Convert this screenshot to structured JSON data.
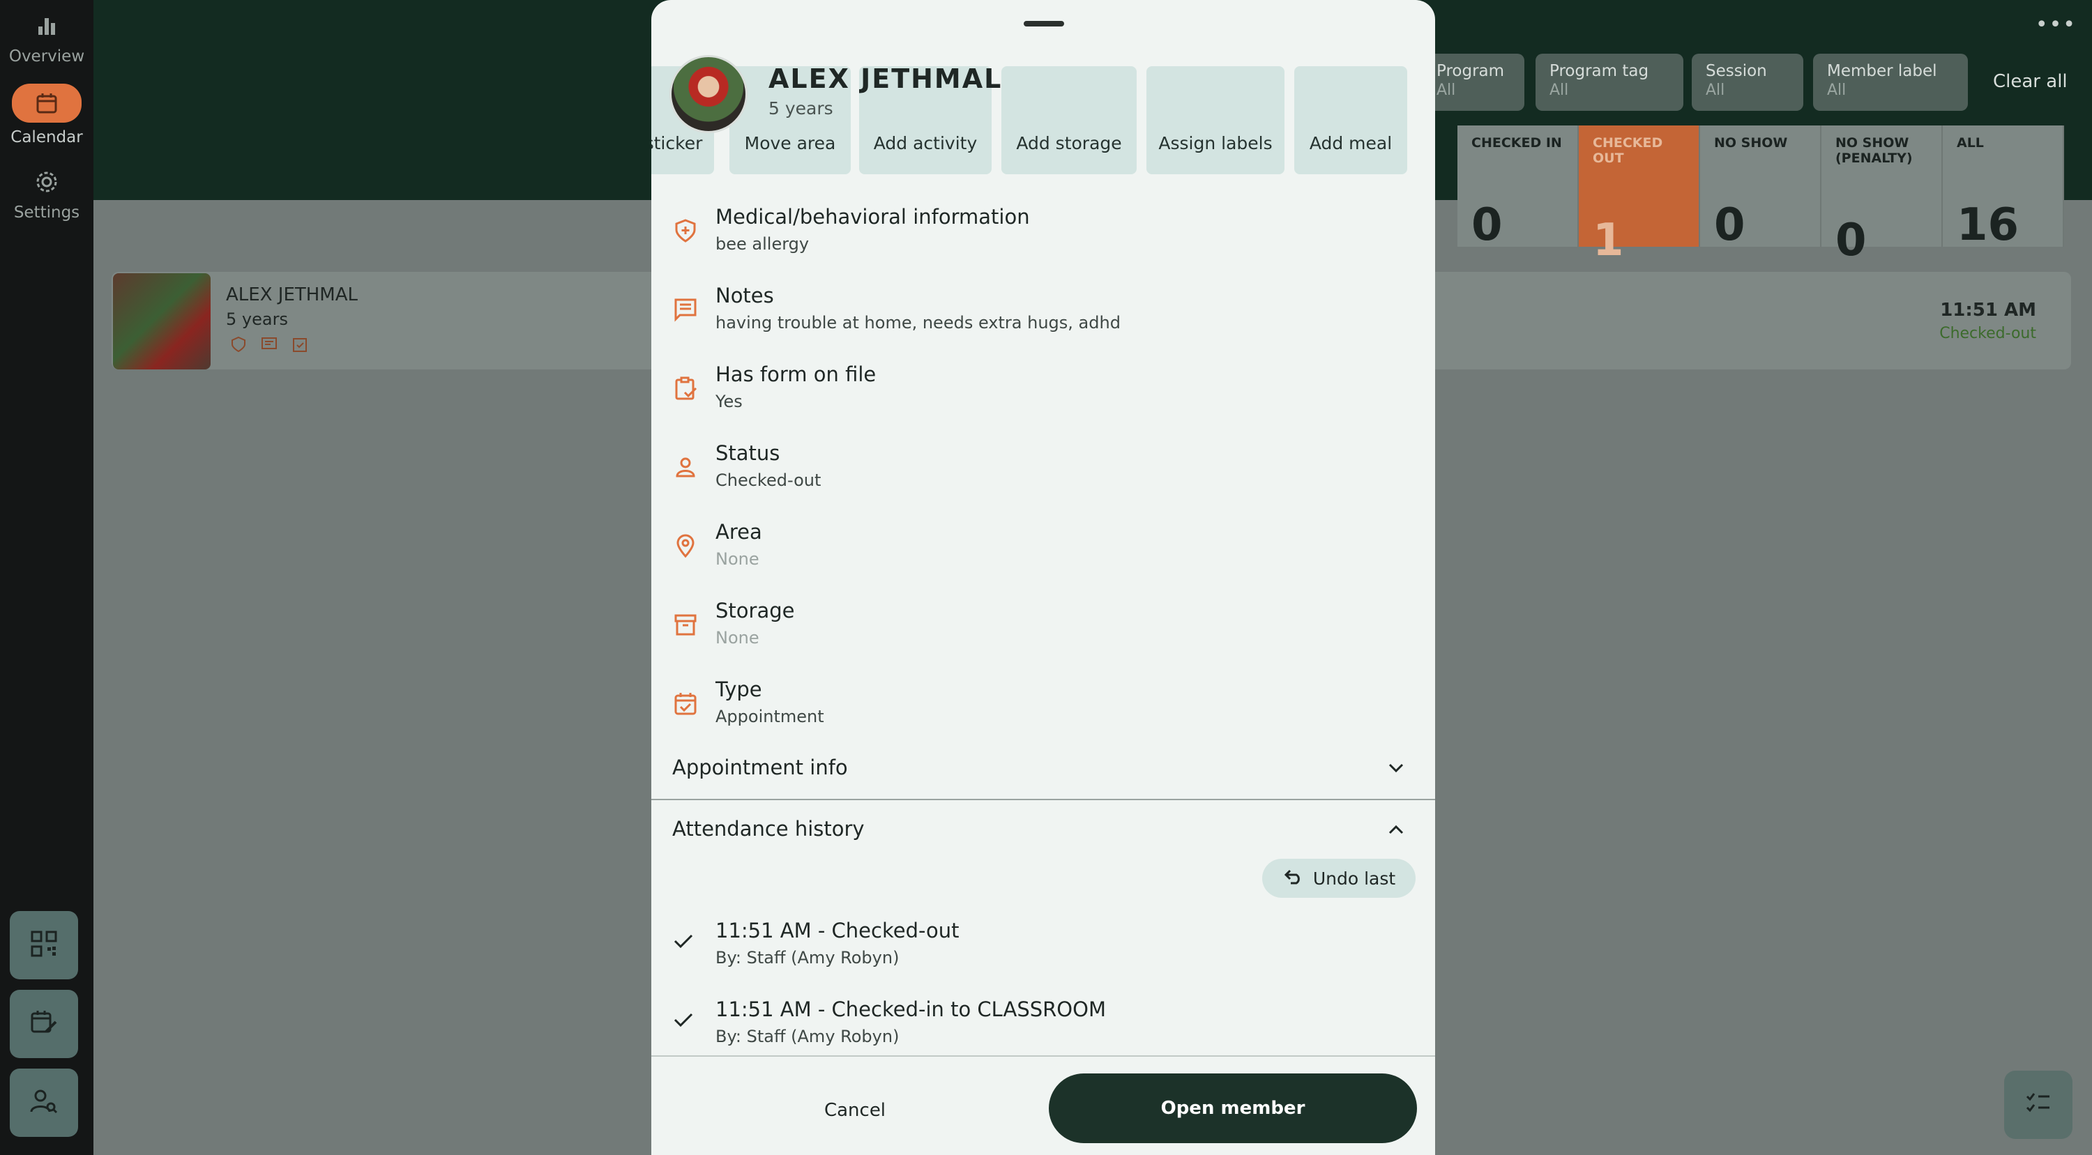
{
  "nav": {
    "items": [
      {
        "label": "Overview",
        "icon": "bar-chart-icon"
      },
      {
        "label": "Calendar",
        "icon": "calendar-icon"
      },
      {
        "label": "Settings",
        "icon": "gear-icon"
      }
    ],
    "active": "Calendar"
  },
  "filters": [
    {
      "title": "Program",
      "value": "All"
    },
    {
      "title": "Program tag",
      "value": "All"
    },
    {
      "title": "Session",
      "value": "All"
    },
    {
      "title": "Member label",
      "value": "All"
    }
  ],
  "clear_all": "Clear all",
  "stats": [
    {
      "label": "CHECKED IN",
      "count": "0"
    },
    {
      "label": "CHECKED OUT",
      "count": "1"
    },
    {
      "label": "NO SHOW",
      "count": "0"
    },
    {
      "label": "NO SHOW (PENALTY)",
      "count": "0"
    },
    {
      "label": "ALL",
      "count": "16"
    }
  ],
  "list_row": {
    "name": "ALEX JETHMAL",
    "age": "5 years",
    "time": "11:51 AM",
    "status": "Checked-out"
  },
  "sheet": {
    "name": "ALEX JETHMAL",
    "age": "5 years",
    "actions": [
      "sticker",
      "Move area",
      "Add activity",
      "Add storage",
      "Assign labels",
      "Add meal"
    ],
    "info": [
      {
        "label": "Medical/behavioral information",
        "value": "bee allergy",
        "icon": "medical-shield-icon"
      },
      {
        "label": "Notes",
        "value": "having trouble at home, needs extra hugs, adhd",
        "icon": "notes-icon"
      },
      {
        "label": "Has form on file",
        "value": "Yes",
        "icon": "clipboard-check-icon"
      },
      {
        "label": "Status",
        "value": "Checked-out",
        "icon": "person-icon"
      },
      {
        "label": "Area",
        "value": "None",
        "icon": "location-pin-icon"
      },
      {
        "label": "Storage",
        "value": "None",
        "icon": "archive-box-icon"
      },
      {
        "label": "Type",
        "value": "Appointment",
        "icon": "calendar-check-icon"
      }
    ],
    "appointment_info": "Appointment info",
    "attendance_history": "Attendance history",
    "undo_last": "Undo last",
    "history": [
      {
        "title": "11:51 AM - Checked-out",
        "by": "By: Staff (Amy Robyn)"
      },
      {
        "title": "11:51 AM - Checked-in to CLASSROOM",
        "by": "By: Staff (Amy Robyn)"
      }
    ],
    "cancel": "Cancel",
    "open_member": "Open member"
  },
  "colors": {
    "accent": "#e0733f",
    "dark_green": "#132b21",
    "button_dark": "#1c3229",
    "chip": "#d3e4e1"
  }
}
